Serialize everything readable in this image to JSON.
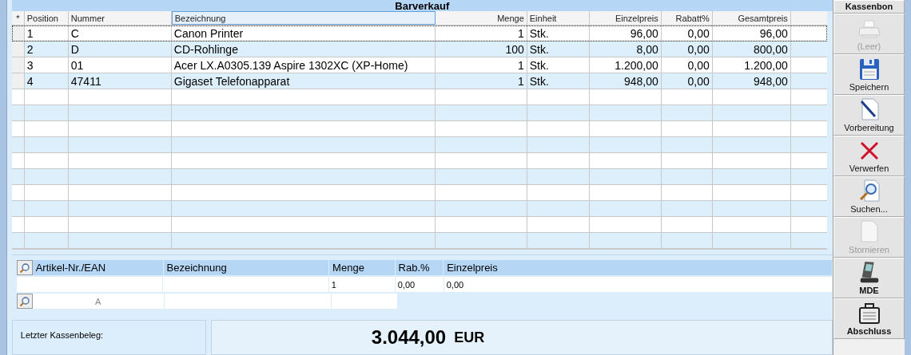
{
  "title": "Barverkauf",
  "table": {
    "marker_header": "*",
    "columns": [
      "Position",
      "Nummer",
      "Bezeichnung",
      "Menge",
      "Einheit",
      "Einzelpreis",
      "Rabatt%",
      "Gesamtpreis"
    ],
    "rows": [
      {
        "selected": true,
        "cells": [
          "1",
          "C",
          "Canon Printer",
          "1",
          "Stk.",
          "96,00",
          "0,00",
          "96,00"
        ]
      },
      {
        "selected": false,
        "cells": [
          "2",
          "D",
          "CD-Rohlinge",
          "100",
          "Stk.",
          "8,00",
          "0,00",
          "800,00"
        ]
      },
      {
        "selected": false,
        "cells": [
          "3",
          "01",
          "Acer LX.A0305.139 Aspire 1302XC (XP-Home)",
          "1",
          "Stk.",
          "1.200,00",
          "0,00",
          "1.200,00"
        ]
      },
      {
        "selected": false,
        "cells": [
          "4",
          "47411",
          "Gigaset Telefonapparat",
          "1",
          "Stk.",
          "948,00",
          "0,00",
          "948,00"
        ]
      }
    ]
  },
  "entry": {
    "columns": [
      {
        "label": "Artikel-Nr./EAN"
      },
      {
        "label": "Bezeichnung"
      },
      {
        "label": "Menge",
        "value": "1"
      },
      {
        "label": "Rab.%",
        "value": "0,00"
      },
      {
        "label": "Einzelpreis",
        "value": "0,00"
      }
    ],
    "second_row_placeholder": "A"
  },
  "last_receipt": {
    "label": "Letzter Kassenbeleg:"
  },
  "total": {
    "amount": "3.044,00",
    "currency": "EUR"
  },
  "sidebar": [
    {
      "kind": "text",
      "label": "Kassenbon",
      "bold": true,
      "disabled": false
    },
    {
      "kind": "printer",
      "label": "(Leer)",
      "bold": false,
      "disabled": true
    },
    {
      "kind": "floppy",
      "label": "Speichern",
      "bold": false,
      "disabled": false
    },
    {
      "kind": "document",
      "label": "Vorbereitung",
      "bold": false,
      "disabled": false
    },
    {
      "kind": "cross",
      "label": "Verwerfen",
      "bold": false,
      "disabled": false
    },
    {
      "kind": "search",
      "label": "Suchen...",
      "bold": false,
      "disabled": false
    },
    {
      "kind": "page",
      "label": "Stornieren",
      "bold": false,
      "disabled": true
    },
    {
      "kind": "handheld",
      "label": "MDE",
      "bold": true,
      "disabled": false
    },
    {
      "kind": "briefcase",
      "label": "Abschluss",
      "bold": true,
      "disabled": false
    }
  ]
}
